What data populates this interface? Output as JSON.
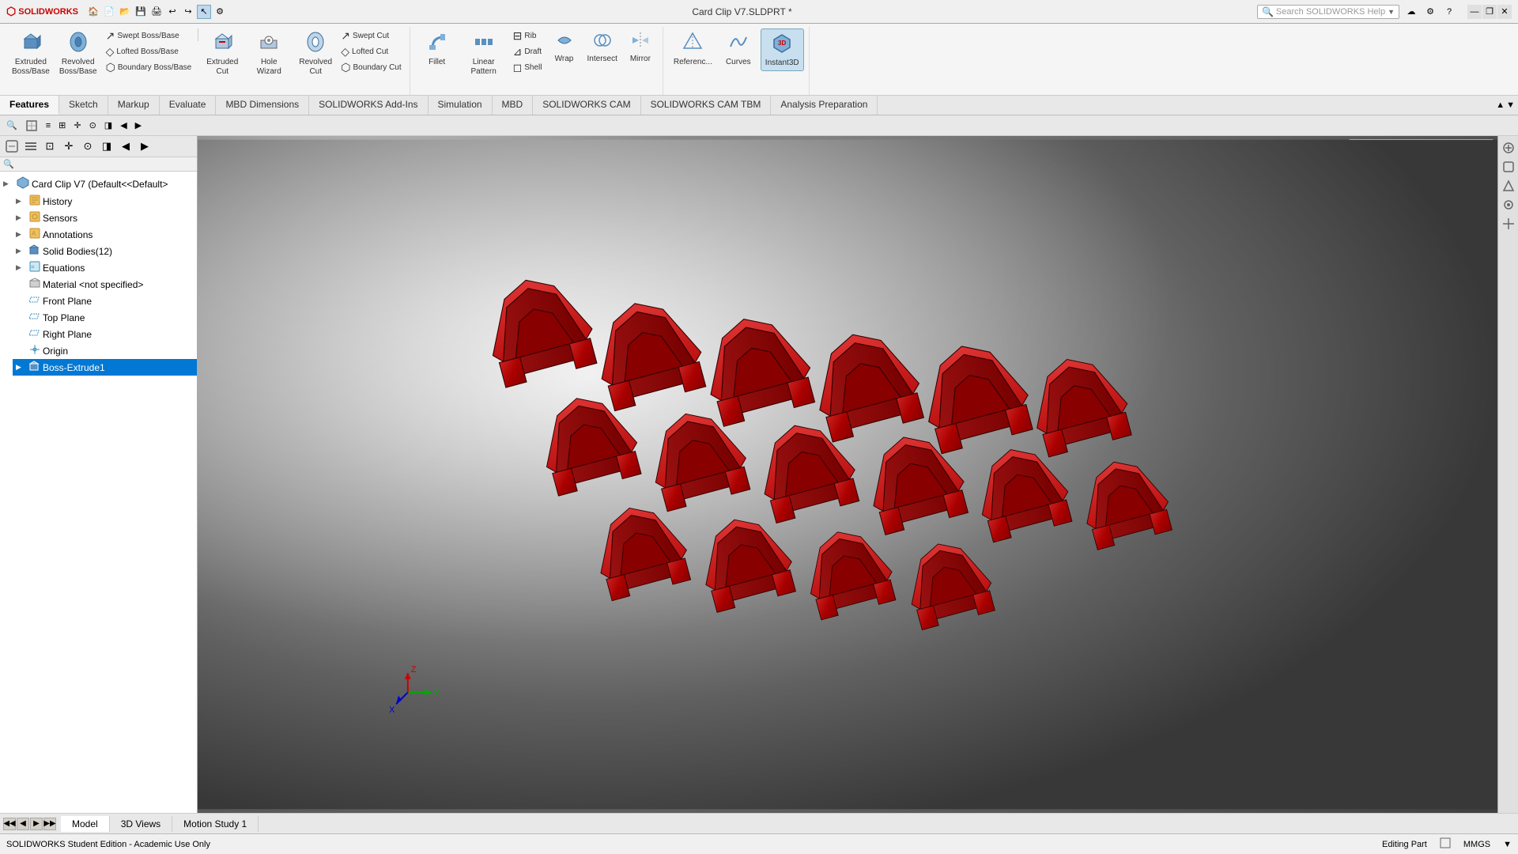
{
  "app": {
    "name": "SOLIDWORKS",
    "title": "Card Clip V7.SLDPRT *",
    "edition": "SOLIDWORKS Student Edition - Academic Use Only",
    "status": "Editing Part",
    "units": "MMGS"
  },
  "titlebar": {
    "logo": "SW",
    "title": "Card Clip V7.SLDPRT *",
    "help_placeholder": "Search SOLIDWORKS Help",
    "window_controls": [
      "—",
      "❐",
      "✕"
    ]
  },
  "ribbon": {
    "groups": [
      {
        "id": "extrude-group",
        "items": [
          {
            "id": "extruded-boss",
            "label": "Extruded\nBoss/Base",
            "icon": "⬛"
          },
          {
            "id": "revolved-boss",
            "label": "Revolved\nBoss/Base",
            "icon": "🔄"
          },
          {
            "id": "cuts-col",
            "type": "col",
            "items": [
              {
                "id": "swept-boss",
                "label": "Swept Boss/Base",
                "icon": "↗"
              },
              {
                "id": "lofted-boss",
                "label": "Lofted Boss/Base",
                "icon": "◇"
              },
              {
                "id": "boundary-boss",
                "label": "Boundary Boss/Base",
                "icon": "⬡"
              }
            ]
          },
          {
            "id": "extruded-cut",
            "label": "Extruded\nCut",
            "icon": "⬛"
          },
          {
            "id": "hole-wizard",
            "label": "Hole Wizard",
            "icon": "⭕"
          },
          {
            "id": "revolved-cut",
            "label": "Revolved\nCut",
            "icon": "🔄"
          },
          {
            "id": "cuts-col2",
            "type": "col",
            "items": [
              {
                "id": "swept-cut",
                "label": "Swept Cut",
                "icon": "↗"
              },
              {
                "id": "lofted-cut",
                "label": "Lofted Cut",
                "icon": "◇"
              },
              {
                "id": "boundary-cut",
                "label": "Boundary Cut",
                "icon": "⬡"
              }
            ]
          }
        ],
        "label": ""
      },
      {
        "id": "features-group",
        "items": [
          {
            "id": "fillet",
            "label": "Fillet",
            "icon": "◜"
          },
          {
            "id": "linear-pattern",
            "label": "Linear Pattern",
            "icon": "⠿"
          },
          {
            "id": "features-col",
            "type": "col",
            "items": [
              {
                "id": "rib",
                "label": "Rib",
                "icon": "⊟"
              },
              {
                "id": "draft",
                "label": "Draft",
                "icon": "⊿"
              },
              {
                "id": "shell",
                "label": "Shell",
                "icon": "◻"
              }
            ]
          },
          {
            "id": "wrap",
            "label": "Wrap",
            "icon": "🌀"
          },
          {
            "id": "intersect",
            "label": "Intersect",
            "icon": "⊗"
          },
          {
            "id": "mirror",
            "label": "Mirror",
            "icon": "⬜"
          }
        ],
        "label": ""
      },
      {
        "id": "reference-group",
        "items": [
          {
            "id": "reference-geometry",
            "label": "Reference\nGeometry",
            "icon": "⬡"
          },
          {
            "id": "curves",
            "label": "Curves",
            "icon": "〜"
          },
          {
            "id": "instant3d",
            "label": "Instant3D",
            "icon": "⚡",
            "highlighted": true
          }
        ],
        "label": ""
      }
    ],
    "tabs": [
      {
        "id": "features",
        "label": "Features",
        "active": true
      },
      {
        "id": "sketch",
        "label": "Sketch"
      },
      {
        "id": "markup",
        "label": "Markup"
      },
      {
        "id": "evaluate",
        "label": "Evaluate"
      },
      {
        "id": "mbd-dimensions",
        "label": "MBD Dimensions"
      },
      {
        "id": "solidworks-addins",
        "label": "SOLIDWORKS Add-Ins"
      },
      {
        "id": "simulation",
        "label": "Simulation"
      },
      {
        "id": "mbd",
        "label": "MBD"
      },
      {
        "id": "solidworks-cam",
        "label": "SOLIDWORKS CAM"
      },
      {
        "id": "solidworks-cam-tbm",
        "label": "SOLIDWORKS CAM TBM"
      },
      {
        "id": "analysis-prep",
        "label": "Analysis Preparation"
      }
    ]
  },
  "left_panel": {
    "toolbar": [
      "⊕",
      "≡",
      "⊡",
      "✛",
      "⊙",
      "◨",
      "▶",
      "◀"
    ],
    "tree_toolbar": [
      "⊞",
      "⊡",
      "▶",
      "◀"
    ],
    "tree": [
      {
        "id": "root",
        "label": "Card Clip V7  (Default<<Default>",
        "icon": "📋",
        "indent": 0,
        "expand": "▶"
      },
      {
        "id": "history",
        "label": "History",
        "icon": "📁",
        "indent": 1,
        "expand": "▶"
      },
      {
        "id": "sensors",
        "label": "Sensors",
        "icon": "📡",
        "indent": 1,
        "expand": "▶"
      },
      {
        "id": "annotations",
        "label": "Annotations",
        "icon": "📝",
        "indent": 1,
        "expand": "▶"
      },
      {
        "id": "solid-bodies",
        "label": "Solid Bodies(12)",
        "icon": "⬛",
        "indent": 1,
        "expand": "▶"
      },
      {
        "id": "equations",
        "label": "Equations",
        "icon": "=",
        "indent": 1,
        "expand": "▶"
      },
      {
        "id": "material",
        "label": "Material <not specified>",
        "icon": "◈",
        "indent": 1,
        "expand": ""
      },
      {
        "id": "front-plane",
        "label": "Front Plane",
        "icon": "▱",
        "indent": 1,
        "expand": ""
      },
      {
        "id": "top-plane",
        "label": "Top Plane",
        "icon": "▱",
        "indent": 1,
        "expand": ""
      },
      {
        "id": "right-plane",
        "label": "Right Plane",
        "icon": "▱",
        "indent": 1,
        "expand": ""
      },
      {
        "id": "origin",
        "label": "Origin",
        "icon": "⊕",
        "indent": 1,
        "expand": ""
      },
      {
        "id": "boss-extrude1",
        "label": "Boss-Extrude1",
        "icon": "⬛",
        "indent": 1,
        "expand": "▶",
        "selected": true
      }
    ]
  },
  "viewport": {
    "toolbar_icons": [
      "🔍",
      "🎨",
      "💡",
      "📷",
      "⊞",
      "◉",
      "🔧",
      "…"
    ]
  },
  "right_sidebar": {
    "icons": [
      "⊕",
      "🔍",
      "📐",
      "◉",
      "⊙"
    ]
  },
  "bottom_tabs": {
    "scroll": [
      "◀◀",
      "◀",
      "▶",
      "▶▶"
    ],
    "tabs": [
      {
        "id": "model",
        "label": "Model",
        "active": true
      },
      {
        "id": "3d-views",
        "label": "3D Views"
      },
      {
        "id": "motion-study-1",
        "label": "Motion Study 1"
      }
    ]
  },
  "statusbar": {
    "edition": "SOLIDWORKS Student Edition - Academic Use Only",
    "editing": "Editing Part",
    "units": "MMGS"
  }
}
